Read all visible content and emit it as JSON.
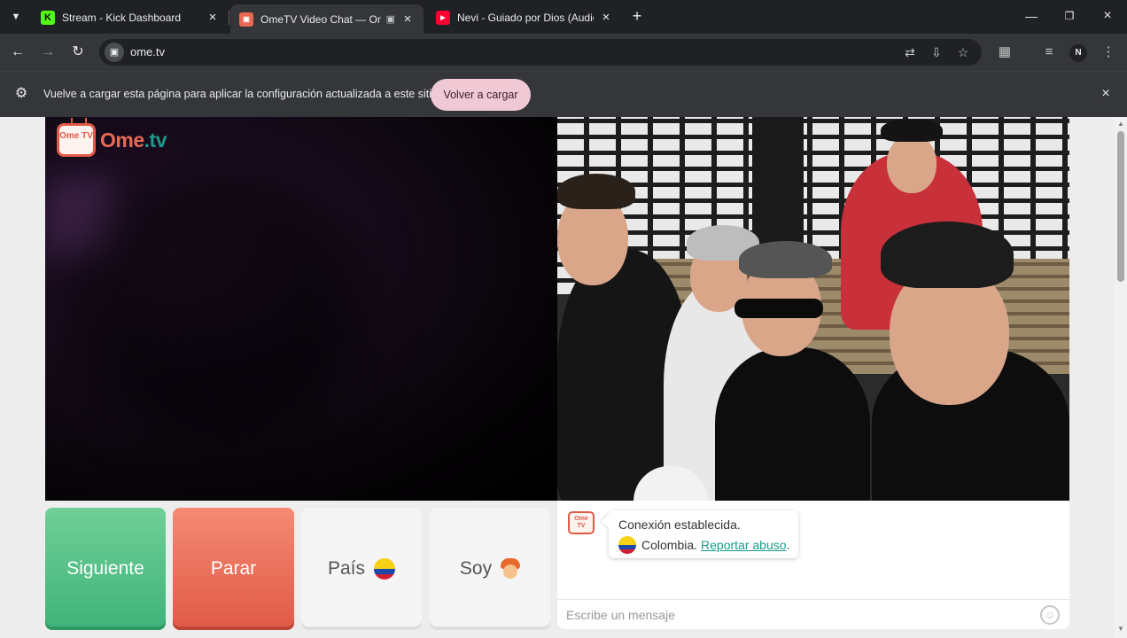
{
  "browser": {
    "tabs": [
      {
        "title": "Stream - Kick Dashboard",
        "favicon": "kick-icon",
        "active": false
      },
      {
        "title": "OmeTV Video Chat — Ome",
        "favicon": "ometv-icon",
        "active": true
      },
      {
        "title": "Nevi - Guiado por Dios (Audio",
        "favicon": "youtube-icon",
        "active": false
      }
    ],
    "url": "ome.tv",
    "profile_initial": "N",
    "icons": {
      "tab_search": "chevron-down-icon",
      "close": "close-icon",
      "new_tab": "plus-icon",
      "back": "back-arrow-icon",
      "forward": "forward-arrow-icon",
      "reload": "reload-icon",
      "translate": "translate-icon",
      "install": "install-app-icon",
      "bookmark": "star-icon",
      "extensions": "puzzle-icon",
      "media": "media-controls-icon",
      "menu": "kebab-menu-icon"
    }
  },
  "infobar": {
    "message": "Vuelve a cargar esta página para aplicar la configuración actualizada a este sitio",
    "button_label": "Volver a cargar"
  },
  "page": {
    "logo": {
      "badge": "Ome TV",
      "word_ome": "Ome",
      "word_tv": ".tv"
    },
    "buttons": {
      "next": "Siguiente",
      "stop": "Parar",
      "country": "País",
      "gender": "Soy"
    },
    "chat": {
      "logo": "Ome TV",
      "status": "Conexión establecida.",
      "country": "Colombia.",
      "report_link": "Reportar abuso",
      "report_suffix": ".",
      "input_placeholder": "Escribe un mensaje"
    },
    "colors": {
      "next": "#3fb37a",
      "stop": "#e05a48",
      "brand_red": "#e86a55",
      "brand_teal": "#1a9b8a",
      "infobar_button": "#f0c9d5"
    }
  }
}
